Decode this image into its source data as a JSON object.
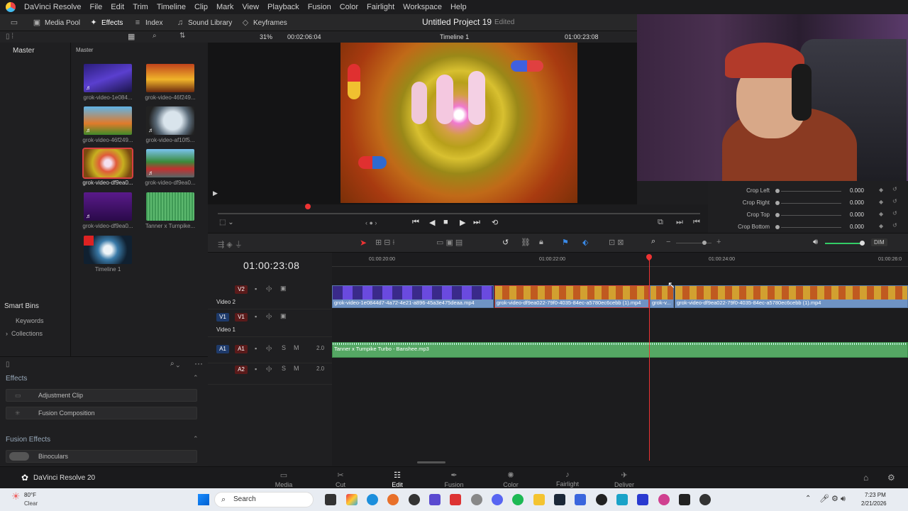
{
  "menubar": {
    "app_name": "DaVinci Resolve",
    "items": [
      "File",
      "Edit",
      "Trim",
      "Timeline",
      "Clip",
      "Mark",
      "View",
      "Playback",
      "Fusion",
      "Color",
      "Fairlight",
      "Workspace",
      "Help"
    ]
  },
  "toolbar": {
    "media_pool": "Media Pool",
    "effects": "Effects",
    "index": "Index",
    "sound_library": "Sound Library",
    "keyframes": "Keyframes",
    "project_title": "Untitled Project 19",
    "project_status": "Edited",
    "zoom": "31%",
    "duration": "00:02:06:04",
    "timeline_name": "Timeline 1",
    "viewer_timecode": "01:00:23:08"
  },
  "media_pool": {
    "bin_master_left": "Master",
    "bin_master_right": "Master",
    "clips": [
      {
        "name": "grok-video-1e084..."
      },
      {
        "name": "grok-video-46f249..."
      },
      {
        "name": "grok-video-46f249..."
      },
      {
        "name": "grok-video-af10f5..."
      },
      {
        "name": "grok-video-df9ea0..."
      },
      {
        "name": "grok-video-df9ea0..."
      },
      {
        "name": "grok-video-df9ea0..."
      },
      {
        "name": "Tanner x Turnpike..."
      },
      {
        "name": "Timeline 1"
      }
    ],
    "smart_bins": "Smart Bins",
    "keywords": "Keywords",
    "collections": "Collections"
  },
  "effects": {
    "header": "Effects",
    "items": [
      "Adjustment Clip",
      "Fusion Composition"
    ],
    "fusion_header": "Fusion Effects",
    "fusion_items": [
      "Binoculars"
    ]
  },
  "inspector": {
    "rows": [
      {
        "label": "Crop Left",
        "value": "0.000"
      },
      {
        "label": "Crop Right",
        "value": "0.000"
      },
      {
        "label": "Crop Top",
        "value": "0.000"
      },
      {
        "label": "Crop Bottom",
        "value": "0.000"
      }
    ]
  },
  "timeline": {
    "timecode": "01:00:23:08",
    "ruler": [
      "01:00:20:00",
      "01:00:22:00",
      "01:00:24:00",
      "01:00:26:0"
    ],
    "dim": "DIM",
    "tracks": {
      "v2_badge": "V2",
      "v2_name": "Video 2",
      "v1_badge": "V1",
      "v1_name": "Video 1",
      "a1_badge": "A1",
      "a1_level": "2.0",
      "a2_badge": "A2",
      "a2_level": "2.0"
    },
    "clips": [
      "grok-video-1e0844d7-4a72-4e21-a896-45a3e475deaa.mp4",
      "grok-video-df9ea022-79f0-4035-84ec-a5780ec6cebb (1).mp4",
      "grok-v...",
      "grok-video-df9ea022-79f0-4035-84ec-a5780ec6cebb (1).mp4"
    ],
    "audio_clip": "Tanner x Turnpike Turbo - Banshee.mp3"
  },
  "pages": {
    "brand": "DaVinci Resolve 20",
    "items": [
      "Media",
      "Cut",
      "Edit",
      "Fusion",
      "Color",
      "Fairlight",
      "Deliver"
    ],
    "active": "Edit"
  },
  "taskbar": {
    "weather_temp": "80°F",
    "weather_desc": "Clear",
    "search": "Search",
    "time": "7:23 PM",
    "date": "2/21/2026"
  }
}
